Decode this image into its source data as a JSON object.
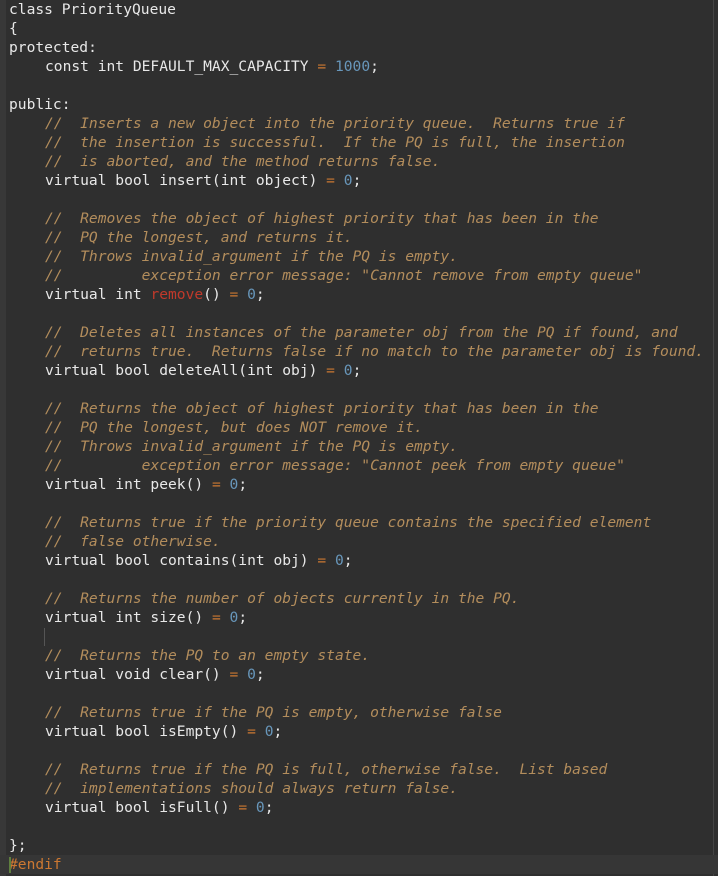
{
  "editor": {
    "class_decl": "class PriorityQueue",
    "open_brace": "{",
    "protected_label": "protected:",
    "const_decl": "const int DEFAULT_MAX_CAPACITY",
    "const_op": "=",
    "const_value": "1000",
    "const_end": ";",
    "public_label": "public:",
    "members": [
      {
        "comments": [
          "//  Inserts a new object into the priority queue.  Returns true if",
          "//  the insertion is successful.  If the PQ is full, the insertion",
          "//  is aborted, and the method returns false."
        ],
        "sig_prefix": "virtual bool insert(int object)",
        "sig_name_red": "",
        "sig_suffix": ""
      },
      {
        "comments": [
          "//  Removes the object of highest priority that has been in the",
          "//  PQ the longest, and returns it.",
          "//  Throws invalid_argument if the PQ is empty.",
          "//         exception error message: \"Cannot remove from empty queue\""
        ],
        "sig_prefix": "virtual int ",
        "sig_name_red": "remove",
        "sig_suffix": "()"
      },
      {
        "comments": [
          "//  Deletes all instances of the parameter obj from the PQ if found, and",
          "//  returns true.  Returns false if no match to the parameter obj is found."
        ],
        "sig_prefix": "virtual bool deleteAll(int obj)",
        "sig_name_red": "",
        "sig_suffix": ""
      },
      {
        "comments": [
          "//  Returns the object of highest priority that has been in the",
          "//  PQ the longest, but does NOT remove it.",
          "//  Throws invalid_argument if the PQ is empty.",
          "//         exception error message: \"Cannot peek from empty queue\""
        ],
        "sig_prefix": "virtual int peek()",
        "sig_name_red": "",
        "sig_suffix": ""
      },
      {
        "comments": [
          "//  Returns true if the priority queue contains the specified element",
          "//  false otherwise."
        ],
        "sig_prefix": "virtual bool contains(int obj)",
        "sig_name_red": "",
        "sig_suffix": ""
      },
      {
        "comments": [
          "//  Returns the number of objects currently in the PQ."
        ],
        "sig_prefix": "virtual int size()",
        "sig_name_red": "",
        "sig_suffix": ""
      },
      {
        "comments": [
          "//  Returns the PQ to an empty state."
        ],
        "sig_prefix": "virtual void clear()",
        "sig_name_red": "",
        "sig_suffix": ""
      },
      {
        "comments": [
          "//  Returns true if the PQ is empty, otherwise false"
        ],
        "sig_prefix": "virtual bool isEmpty()",
        "sig_name_red": "",
        "sig_suffix": ""
      },
      {
        "comments": [
          "//  Returns true if the PQ is full, otherwise false.  List based",
          "//  implementations should always return false."
        ],
        "sig_prefix": "virtual bool isFull()",
        "sig_name_red": "",
        "sig_suffix": ""
      }
    ],
    "pure_op": "=",
    "pure_value": "0",
    "pure_end": ";",
    "close_brace": "};",
    "endif": "#endif"
  },
  "colors": {
    "background": "#2f2f2f",
    "comment": "#b38d5c",
    "keyword": "#e8e8e8",
    "operator": "#cc7832",
    "number": "#6897bb",
    "highlight_red": "#c0392b",
    "preprocessor": "#cc7832"
  }
}
